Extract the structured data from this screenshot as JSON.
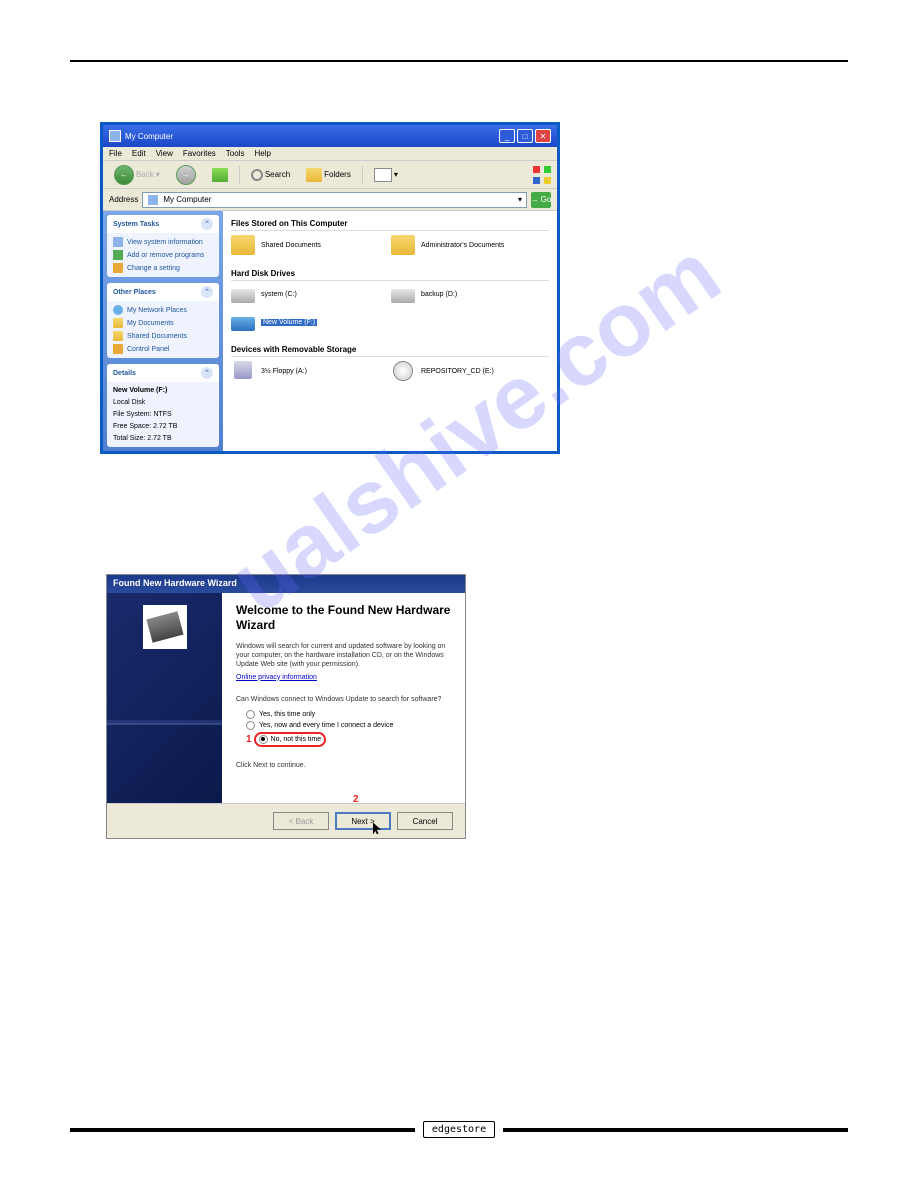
{
  "watermark": "ualshive.com",
  "mycomputer": {
    "title": "My Computer",
    "menu": [
      "File",
      "Edit",
      "View",
      "Favorites",
      "Tools",
      "Help"
    ],
    "back": "Back",
    "search": "Search",
    "folders": "Folders",
    "address_label": "Address",
    "address_value": "My Computer",
    "go": "Go",
    "panels": {
      "system": {
        "title": "System Tasks",
        "links": [
          "View system information",
          "Add or remove programs",
          "Change a setting"
        ]
      },
      "other": {
        "title": "Other Places",
        "links": [
          "My Network Places",
          "My Documents",
          "Shared Documents",
          "Control Panel"
        ]
      },
      "details": {
        "title": "Details",
        "name": "New Volume (F:)",
        "type": "Local Disk",
        "fs": "File System: NTFS",
        "free": "Free Space: 2.72 TB",
        "total": "Total Size: 2.72 TB"
      }
    },
    "sections": {
      "files": {
        "title": "Files Stored on This Computer",
        "items": [
          "Shared Documents",
          "Administrator's Documents"
        ]
      },
      "drives": {
        "title": "Hard Disk Drives",
        "items": [
          "system (C:)",
          "backup (D:)",
          "New Volume (F:)"
        ]
      },
      "devices": {
        "title": "Devices with Removable Storage",
        "items": [
          "3½ Floppy (A:)",
          "REPOSITORY_CD (E:)"
        ]
      }
    }
  },
  "wizard": {
    "title": "Found New Hardware Wizard",
    "heading": "Welcome to the Found New Hardware Wizard",
    "p1": "Windows will search for current and updated software by looking on your computer, on the hardware installation CD, or on the Windows Update Web site (with your permission).",
    "link": "Online privacy information",
    "p2": "Can Windows connect to Windows Update to search for software?",
    "opt1": "Yes, this time only",
    "opt2": "Yes, now and every time I connect a device",
    "opt3": "No, not this time",
    "continue": "Click Next to continue.",
    "back": "< Back",
    "next": "Next >",
    "cancel": "Cancel",
    "annot1": "1",
    "annot2": "2"
  },
  "footer": "edgestore"
}
